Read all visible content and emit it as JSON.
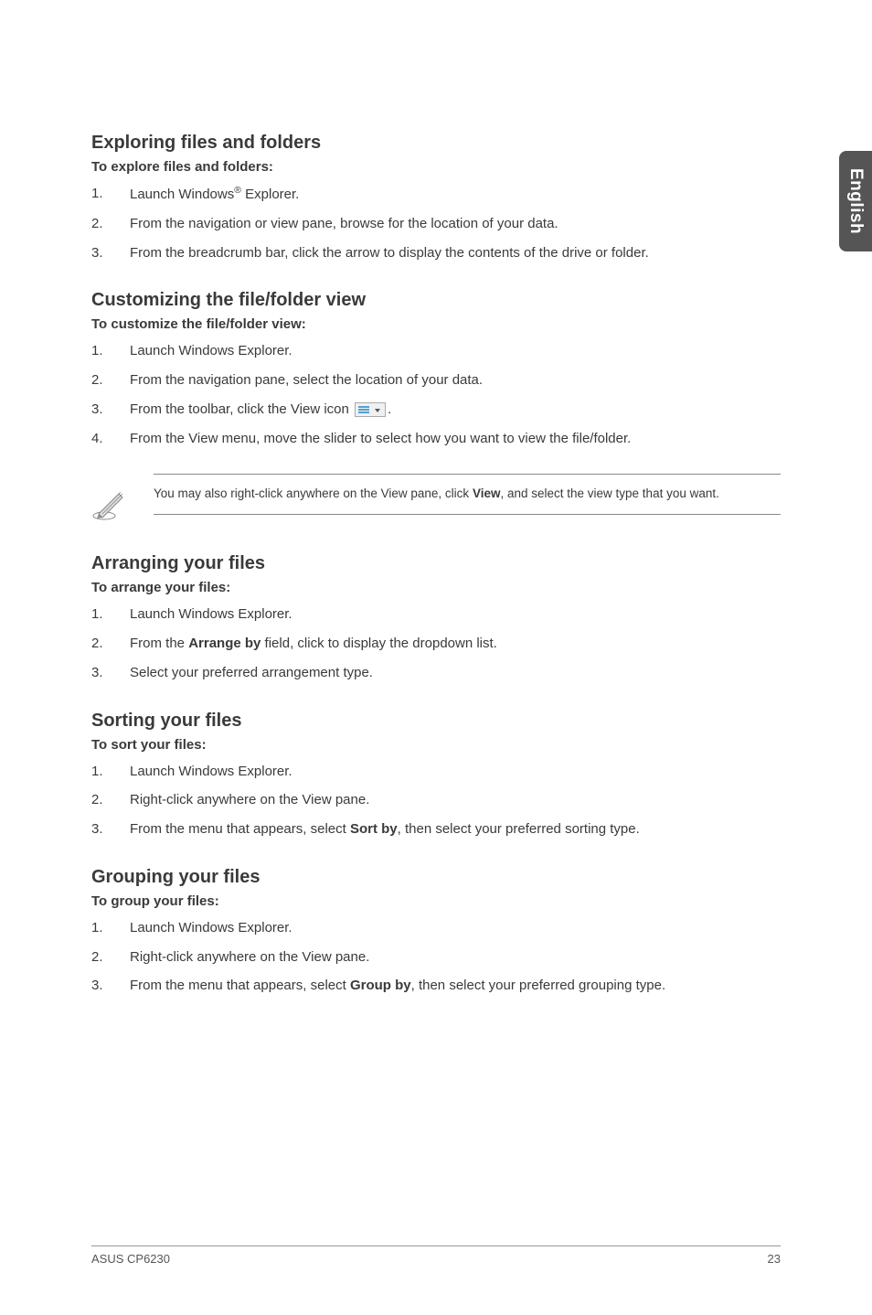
{
  "side_tab": {
    "label": "English"
  },
  "sections": {
    "exploring": {
      "heading": "Exploring files and folders",
      "subhead": "To explore files and folders:",
      "steps": [
        {
          "pre": "Launch Windows",
          "sup": "®",
          "post": " Explorer."
        },
        {
          "text": "From the navigation or view pane, browse for the location of your data."
        },
        {
          "text": "From the breadcrumb bar, click the arrow to display the contents of the drive or folder."
        }
      ]
    },
    "customizing": {
      "heading": "Customizing the file/folder view",
      "subhead": "To customize the file/folder view:",
      "steps": [
        {
          "text": "Launch Windows Explorer."
        },
        {
          "text": "From the navigation pane, select the location of your data."
        },
        {
          "pre": "From the toolbar, click the View icon ",
          "icon": "view-icon",
          "post": "."
        },
        {
          "text": "From the View menu, move the slider to select how you want to view the file/folder."
        }
      ],
      "note": {
        "pre": "You may also right-click anywhere on the View pane, click ",
        "bold": "View",
        "post": ", and select the view type that you want."
      }
    },
    "arranging": {
      "heading": "Arranging your files",
      "subhead": "To arrange your files:",
      "steps": [
        {
          "text": "Launch Windows Explorer."
        },
        {
          "pre": "From the ",
          "bold": "Arrange by",
          "post": " field, click to display the dropdown list."
        },
        {
          "text": "Select your preferred arrangement type."
        }
      ]
    },
    "sorting": {
      "heading": "Sorting your files",
      "subhead": "To sort your files:",
      "steps": [
        {
          "text": "Launch Windows Explorer."
        },
        {
          "text": "Right-click anywhere on the View pane."
        },
        {
          "pre": "From the menu that appears, select ",
          "bold": "Sort by",
          "post": ", then select your preferred sorting type."
        }
      ]
    },
    "grouping": {
      "heading": "Grouping your files",
      "subhead": "To group your files:",
      "steps": [
        {
          "text": "Launch Windows Explorer."
        },
        {
          "text": "Right-click anywhere on the View pane."
        },
        {
          "pre": "From the menu that appears, select ",
          "bold": "Group by",
          "post": ", then select your preferred grouping type."
        }
      ]
    }
  },
  "footer": {
    "left": "ASUS CP6230",
    "right": "23"
  }
}
